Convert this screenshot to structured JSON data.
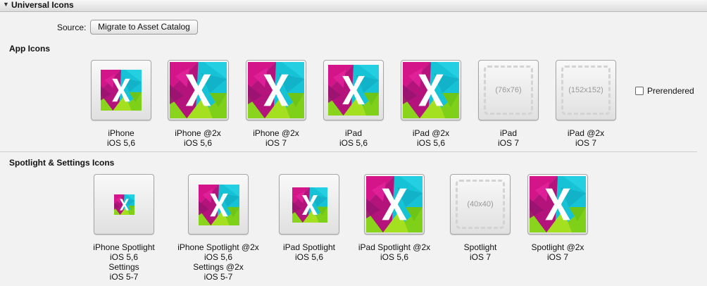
{
  "header": {
    "title": "Universal Icons"
  },
  "source": {
    "label": "Source:",
    "button": "Migrate to Asset Catalog"
  },
  "app_icons": {
    "title": "App Icons",
    "prerendered": "Prerendered",
    "items": [
      {
        "label": "iPhone\niOS 5,6",
        "placeholder": ""
      },
      {
        "label": "iPhone @2x\niOS 5,6",
        "placeholder": ""
      },
      {
        "label": "iPhone @2x\niOS 7",
        "placeholder": ""
      },
      {
        "label": "iPad\niOS 5,6",
        "placeholder": ""
      },
      {
        "label": "iPad @2x\niOS 5,6",
        "placeholder": ""
      },
      {
        "label": "iPad\niOS 7",
        "placeholder": "(76x76)"
      },
      {
        "label": "iPad @2x\niOS 7",
        "placeholder": "(152x152)"
      }
    ]
  },
  "spotlight": {
    "title": "Spotlight & Settings Icons",
    "items": [
      {
        "label": "iPhone Spotlight\niOS 5,6\nSettings\niOS 5-7",
        "placeholder": ""
      },
      {
        "label": "iPhone Spotlight @2x\niOS 5,6\nSettings @2x\niOS 5-7",
        "placeholder": ""
      },
      {
        "label": "iPad Spotlight\niOS 5,6",
        "placeholder": ""
      },
      {
        "label": "iPad Spotlight @2x\niOS 5,6",
        "placeholder": ""
      },
      {
        "label": "Spotlight\niOS 7",
        "placeholder": "(40x40)"
      },
      {
        "label": "Spotlight @2x\niOS 7",
        "placeholder": ""
      }
    ]
  }
}
